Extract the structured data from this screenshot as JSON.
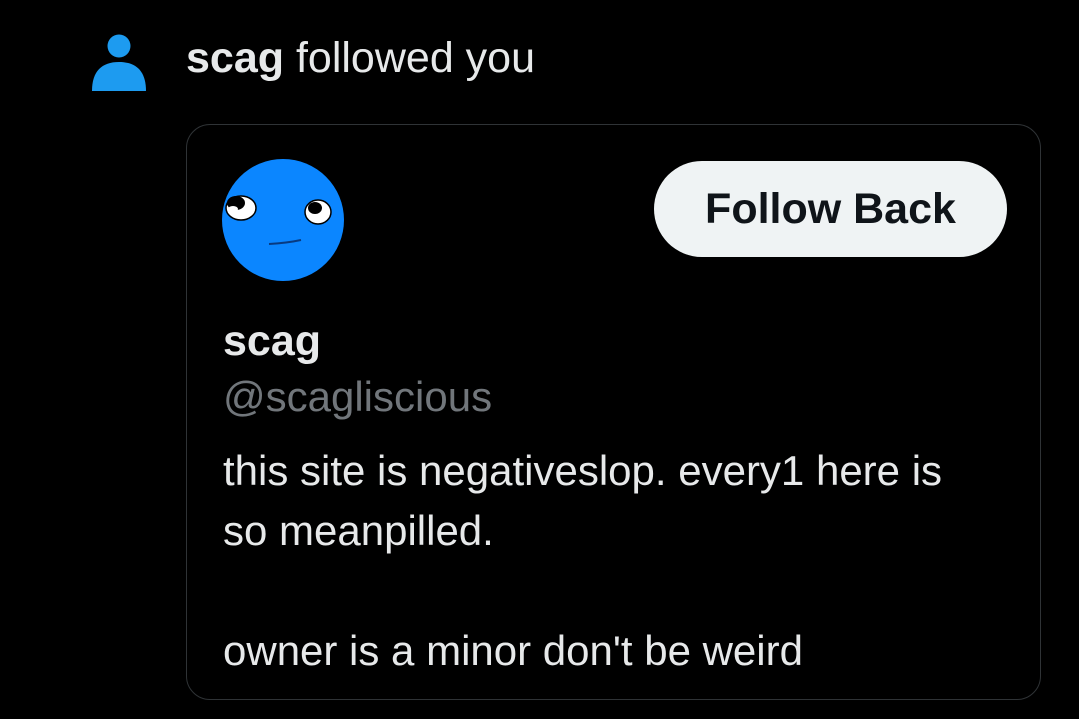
{
  "notification": {
    "icon": "person-icon",
    "icon_color": "#1d9bf0",
    "username": "scag",
    "action_text": "followed you"
  },
  "card": {
    "avatar": "blue-face-avatar",
    "avatar_color": "#0b86ff",
    "follow_button_label": "Follow Back",
    "display_name": "scag",
    "handle": "@scagliscious",
    "bio_lines": [
      "this site is negativeslop. every1 here is",
      "so meanpilled.",
      "",
      "owner is a minor don't be weird"
    ]
  }
}
